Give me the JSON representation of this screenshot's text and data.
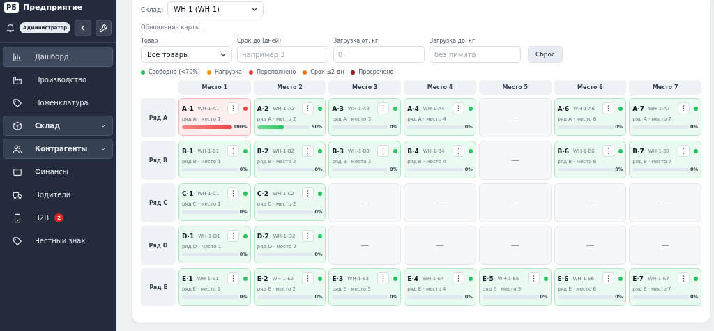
{
  "sidebar": {
    "logo": "РБ",
    "title": "Предприятие",
    "user_badge": "Администратор",
    "items": [
      {
        "label": "Дашборд",
        "kind": "link",
        "selected": true
      },
      {
        "label": "Производство",
        "kind": "link",
        "selected": false
      },
      {
        "label": "Номенклатура",
        "kind": "link",
        "selected": false
      },
      {
        "label": "Склад",
        "kind": "group",
        "selected": false
      },
      {
        "label": "Контрагенты",
        "kind": "group",
        "selected": false
      },
      {
        "label": "Финансы",
        "kind": "link",
        "selected": false
      },
      {
        "label": "Водители",
        "kind": "link",
        "selected": false
      },
      {
        "label": "B2B",
        "kind": "link",
        "selected": false,
        "badge": "2"
      },
      {
        "label": "Честный знак",
        "kind": "link",
        "selected": false
      }
    ]
  },
  "warehouse": {
    "label": "Склад:",
    "value": "WH-1 (WH-1)"
  },
  "status_text": "Обновление карты...",
  "filters": [
    {
      "label": "Товар",
      "kind": "select",
      "value": "Все товары"
    },
    {
      "label": "Срок до (дней)",
      "kind": "input",
      "placeholder": "например 3"
    },
    {
      "label": "Загрузка от, кг",
      "kind": "input",
      "placeholder": "0"
    },
    {
      "label": "Загрузка до, кг",
      "kind": "input",
      "placeholder": "без лимита"
    }
  ],
  "reset_button": "Сброс",
  "legend": [
    {
      "label": "Свободно (<70%)",
      "color": "#22c55e"
    },
    {
      "label": "Нагрузка",
      "color": "#f59e0b"
    },
    {
      "label": "Переполнено",
      "color": "#ef4444"
    },
    {
      "label": "Срок ≤2 дн",
      "color": "#f97316"
    },
    {
      "label": "Просрочено",
      "color": "#991b1b"
    }
  ],
  "grid": {
    "columns": [
      "Место 1",
      "Место 2",
      "Место 3",
      "Место 4",
      "Место 5",
      "Место 6",
      "Место 7"
    ],
    "rows": [
      {
        "label": "Ряд A",
        "cells": [
          {
            "kind": "slot",
            "code": "A·1",
            "id": "WH-1-A1",
            "place": "ряд A · место 1",
            "level": 1,
            "percent": "100%",
            "color": "#ef4444"
          },
          {
            "kind": "slot",
            "code": "A·2",
            "id": "WH-1-A2",
            "place": "ряд A · место 2",
            "level": 0.5,
            "percent": "50%",
            "color": "#22c55e"
          },
          {
            "kind": "slot",
            "code": "A·3",
            "id": "WH-1-A3",
            "place": "ряд A · место 3",
            "level": 0,
            "percent": "0%",
            "color": "#22c55e"
          },
          {
            "kind": "slot",
            "code": "A·4",
            "id": "WH-1-A4",
            "place": "ряд A · место 4",
            "level": 0,
            "percent": "0%",
            "color": "#22c55e"
          },
          {
            "kind": "empty",
            "text": "—"
          },
          {
            "kind": "slot",
            "code": "A·6",
            "id": "WH-1-A6",
            "place": "ряд A · место 6",
            "level": 0,
            "percent": "0%",
            "color": "#22c55e"
          },
          {
            "kind": "slot",
            "code": "A·7",
            "id": "WH-1-A7",
            "place": "ряд A · место 7",
            "level": 0,
            "percent": "0%",
            "color": "#22c55e"
          }
        ]
      },
      {
        "label": "Ряд B",
        "cells": [
          {
            "kind": "slot",
            "code": "B·1",
            "id": "WH-1-B1",
            "place": "ряд B · место 1",
            "level": 0,
            "percent": "0%",
            "color": "#22c55e"
          },
          {
            "kind": "slot",
            "code": "B·2",
            "id": "WH-1-B2",
            "place": "ряд B · место 2",
            "level": 0,
            "percent": "0%",
            "color": "#22c55e"
          },
          {
            "kind": "slot",
            "code": "B·3",
            "id": "WH-1-B3",
            "place": "ряд B · место 3",
            "level": 0,
            "percent": "0%",
            "color": "#22c55e"
          },
          {
            "kind": "slot",
            "code": "B·4",
            "id": "WH-1-B4",
            "place": "ряд B · место 4",
            "level": 0,
            "percent": "0%",
            "color": "#22c55e"
          },
          {
            "kind": "empty",
            "text": "—"
          },
          {
            "kind": "slot",
            "code": "B·6",
            "id": "WH-1-B6",
            "place": "ряд B · место 6",
            "level": 0,
            "percent": "0%",
            "color": "#22c55e"
          },
          {
            "kind": "slot",
            "code": "B·7",
            "id": "WH-1-B7",
            "place": "ряд B · место 7",
            "level": 0,
            "percent": "0%",
            "color": "#22c55e"
          }
        ]
      },
      {
        "label": "Ряд C",
        "cells": [
          {
            "kind": "slot",
            "code": "C·1",
            "id": "WH-1-C1",
            "place": "ряд C · место 1",
            "level": 0,
            "percent": "0%",
            "color": "#22c55e"
          },
          {
            "kind": "slot",
            "code": "C·2",
            "id": "WH-1-C2",
            "place": "ряд C · место 2",
            "level": 0,
            "percent": "0%",
            "color": "#22c55e"
          },
          {
            "kind": "empty",
            "text": "—"
          },
          {
            "kind": "empty",
            "text": "—"
          },
          {
            "kind": "empty",
            "text": "—"
          },
          {
            "kind": "empty",
            "text": "—"
          },
          {
            "kind": "empty",
            "text": "—"
          }
        ]
      },
      {
        "label": "Ряд D",
        "cells": [
          {
            "kind": "slot",
            "code": "D·1",
            "id": "WH-1-D1",
            "place": "ряд D · место 1",
            "level": 0,
            "percent": "0%",
            "color": "#22c55e"
          },
          {
            "kind": "slot",
            "code": "D·2",
            "id": "WH-1-D2",
            "place": "ряд D · место 2",
            "level": 0,
            "percent": "0%",
            "color": "#22c55e"
          },
          {
            "kind": "empty",
            "text": "—"
          },
          {
            "kind": "empty",
            "text": "—"
          },
          {
            "kind": "empty",
            "text": "—"
          },
          {
            "kind": "empty",
            "text": "—"
          },
          {
            "kind": "empty",
            "text": "—"
          }
        ]
      },
      {
        "label": "Ряд E",
        "cells": [
          {
            "kind": "slot",
            "code": "E·1",
            "id": "WH-1-E1",
            "place": "ряд E · место 1",
            "level": 0,
            "percent": "0%",
            "color": "#22c55e"
          },
          {
            "kind": "slot",
            "code": "E·2",
            "id": "WH-1-E2",
            "place": "ряд E · место 2",
            "level": 0,
            "percent": "0%",
            "color": "#22c55e"
          },
          {
            "kind": "slot",
            "code": "E·3",
            "id": "WH-1-E3",
            "place": "ряд E · место 3",
            "level": 0,
            "percent": "0%",
            "color": "#22c55e"
          },
          {
            "kind": "slot",
            "code": "E·4",
            "id": "WH-1-E4",
            "place": "ряд E · место 4",
            "level": 0,
            "percent": "0%",
            "color": "#22c55e"
          },
          {
            "kind": "slot",
            "code": "E·5",
            "id": "WH-1-E5",
            "place": "ряд E · место 5",
            "level": 0,
            "percent": "0%",
            "color": "#22c55e"
          },
          {
            "kind": "slot",
            "code": "E·6",
            "id": "WH-1-E6",
            "place": "ряд E · место 6",
            "level": 0,
            "percent": "0%",
            "color": "#22c55e"
          },
          {
            "kind": "slot",
            "code": "E·7",
            "id": "WH-1-E7",
            "place": "ряд E · место 7",
            "level": 0,
            "percent": "0%",
            "color": "#22c55e"
          }
        ]
      }
    ]
  }
}
